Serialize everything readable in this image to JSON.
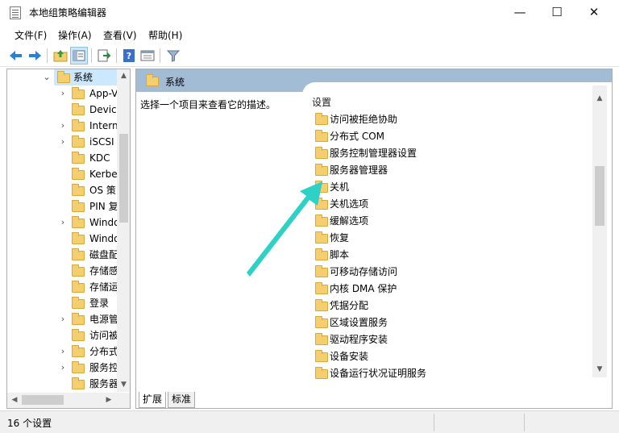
{
  "window": {
    "title": "本地组策略编辑器",
    "minimize_glyph": "—",
    "maximize_glyph": "☐",
    "close_glyph": "✕"
  },
  "menu": {
    "items": [
      "文件(F)",
      "操作(A)",
      "查看(V)",
      "帮助(H)"
    ]
  },
  "toolbar": {
    "buttons": [
      "back-arrow-icon",
      "forward-arrow-icon",
      "up-folder-icon",
      "show-hide-tree-icon",
      "export-list-icon",
      "help-icon",
      "properties-icon",
      "filter-icon"
    ]
  },
  "tree": {
    "selected": "系统",
    "items": [
      {
        "label": "系统",
        "expander": "⌄"
      },
      {
        "label": "App-V",
        "expander": "›"
      },
      {
        "label": "Device",
        "expander": ""
      },
      {
        "label": "Intern",
        "expander": "›"
      },
      {
        "label": "iSCSI",
        "expander": "›"
      },
      {
        "label": "KDC",
        "expander": ""
      },
      {
        "label": "Kerbe",
        "expander": ""
      },
      {
        "label": "OS 策",
        "expander": ""
      },
      {
        "label": "PIN 复",
        "expander": ""
      },
      {
        "label": "Windo",
        "expander": "›"
      },
      {
        "label": "Windo",
        "expander": ""
      },
      {
        "label": "磁盘配",
        "expander": ""
      },
      {
        "label": "存储感",
        "expander": ""
      },
      {
        "label": "存储运",
        "expander": ""
      },
      {
        "label": "登录",
        "expander": ""
      },
      {
        "label": "电源管",
        "expander": "›"
      },
      {
        "label": "访问被",
        "expander": ""
      },
      {
        "label": "分布式",
        "expander": "›"
      },
      {
        "label": "服务控",
        "expander": "›"
      },
      {
        "label": "服务器",
        "expander": ""
      }
    ]
  },
  "right_pane": {
    "header": "系统",
    "description": "选择一个项目来查看它的描述。",
    "column_header": "设置",
    "items": [
      "访问被拒绝协助",
      "分布式 COM",
      "服务控制管理器设置",
      "服务器管理器",
      "关机",
      "关机选项",
      "缓解选项",
      "恢复",
      "脚本",
      "可移动存储访问",
      "内核 DMA 保护",
      "凭据分配",
      "区域设置服务",
      "驱动程序安装",
      "设备安装",
      "设备运行状况证明服务"
    ]
  },
  "tabs": [
    "扩展",
    "标准"
  ],
  "status": {
    "text": "16 个设置"
  },
  "colors": {
    "header_blue": "#a3bcd5",
    "annotation_arrow": "#2ed1c6",
    "folder": "#f5cf6f"
  }
}
